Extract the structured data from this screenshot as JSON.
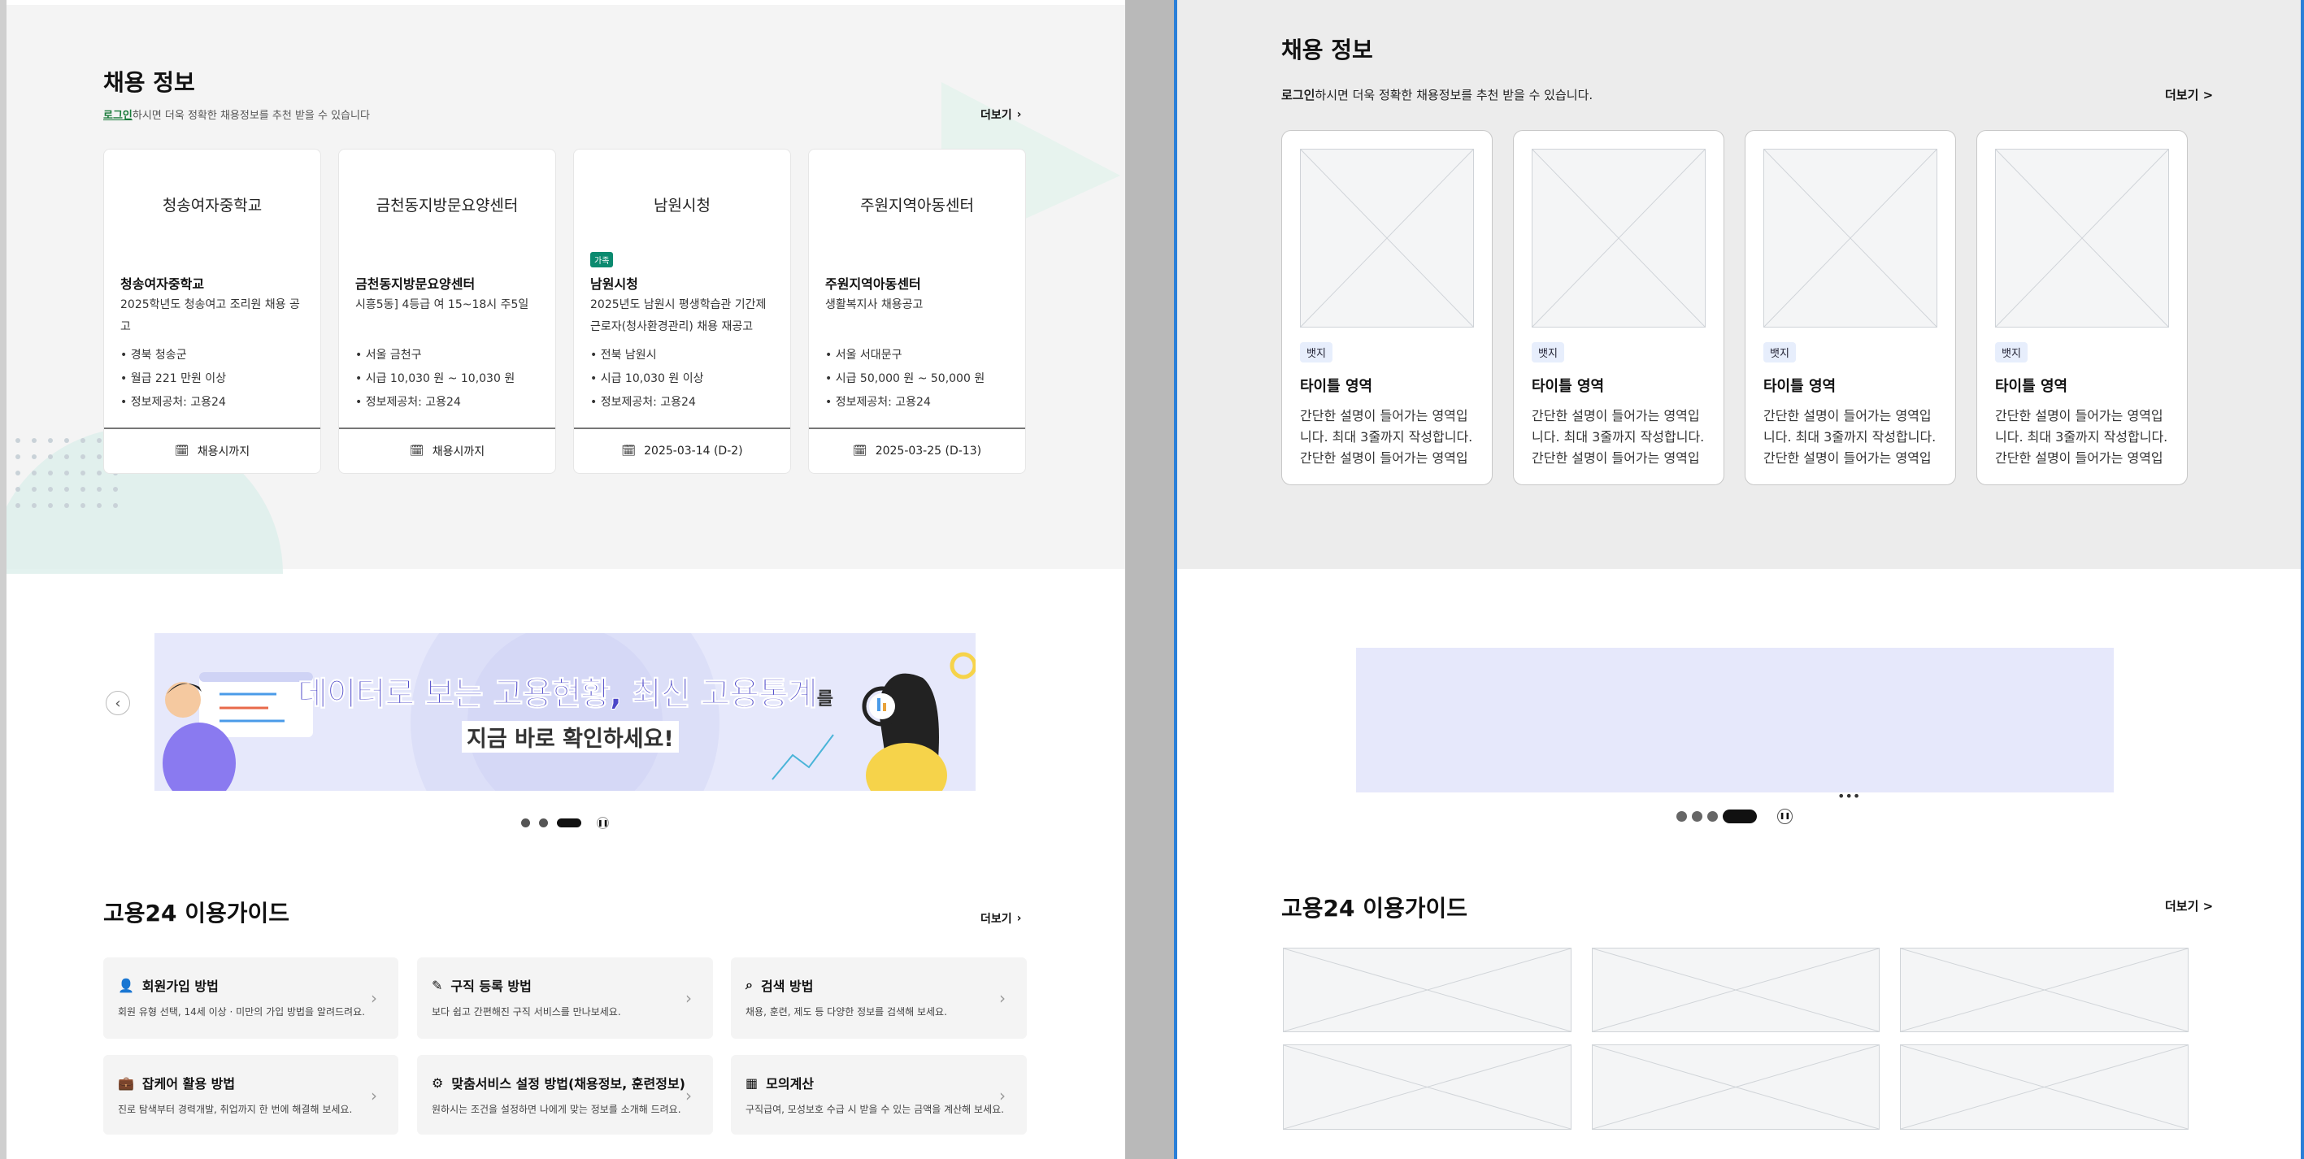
{
  "left": {
    "jobs": {
      "title": "채용 정보",
      "login_link": "로그인",
      "subtitle_rest": "하시면 더욱 정확한 채용정보를 추천 받을 수 있습니다",
      "more": "더보기",
      "cards": [
        {
          "logo": "청송여자중학교",
          "name": "청송여자중학교",
          "desc": "2025학년도 청송여고 조리원 채용 공고",
          "items": [
            "경북 청송군",
            "월급 221 만원 이상",
            "정보제공처: 고용24"
          ],
          "deadline": "채용시까지",
          "badge": ""
        },
        {
          "logo": "금천동지방문요양센터",
          "name": "금천동지방문요양센터",
          "desc": "시흥5동] 4등급 여 15~18시 주5일",
          "items": [
            "서울 금천구",
            "시급 10,030 원 ~ 10,030 원",
            "정보제공처: 고용24"
          ],
          "deadline": "채용시까지",
          "badge": ""
        },
        {
          "logo": "남원시청",
          "name": "남원시청",
          "desc": "2025년도 남원시 평생학습관 기간제근로자(청사환경관리) 채용 재공고",
          "items": [
            "전북 남원시",
            "시급 10,030 원 이상",
            "정보제공처: 고용24"
          ],
          "deadline": "2025-03-14 (D-2)",
          "badge": "가족"
        },
        {
          "logo": "주원지역아동센터",
          "name": "주원지역아동센터",
          "desc": "생활복지사 채용공고",
          "items": [
            "서울 서대문구",
            "시급 50,000 원 ~ 50,000 원",
            "정보제공처: 고용24"
          ],
          "deadline": "2025-03-25 (D-13)",
          "badge": ""
        }
      ]
    },
    "banner": {
      "headline": "데이터로 보는 고용현황, 최신 고용통계",
      "headline_suffix": "를",
      "subline": "지금 바로 확인하세요!"
    },
    "guide": {
      "title": "고용24 이용가이드",
      "more": "더보기",
      "items": [
        {
          "title": "회원가입 방법",
          "desc": "회원 유형 선택, 14세 이상 · 미만의 가입 방법을 알려드려요.",
          "icon": "user-icon"
        },
        {
          "title": "구직 등록 방법",
          "desc": "보다 쉽고 간편해진 구직 서비스를 만나보세요.",
          "icon": "pencil-icon"
        },
        {
          "title": "검색 방법",
          "desc": "채용, 훈련, 제도 등 다양한 정보를 검색해 보세요.",
          "icon": "search-icon"
        },
        {
          "title": "잡케어 활용 방법",
          "desc": "진로 탐색부터 경력개발, 취업까지 한 번에 해결해 보세요.",
          "icon": "briefcase-icon"
        },
        {
          "title": "맞춤서비스 설정 방법(채용정보, 훈련정보)",
          "desc": "원하시는 조건을 설정하면 나에게 맞는 정보를 소개해 드려요.",
          "icon": "gear-icon"
        },
        {
          "title": "모의계산",
          "desc": "구직급여, 모성보호 수급 시 받을 수 있는 금액을 계산해 보세요.",
          "icon": "calculator-icon"
        }
      ]
    }
  },
  "right": {
    "jobs": {
      "title": "채용 정보",
      "login_link": "로그인",
      "subtitle_rest": "하시면 더욱 정확한 채용정보를 추천 받을 수 있습니다.",
      "more": "더보기 >",
      "cards": [
        {
          "badge": "뱃지",
          "title": "타이틀 영역",
          "desc": "간단한 설명이 들어가는 영역입니다. 최대 3줄까지 작성합니다. 간단한 설명이 들어가는 영역입니다."
        },
        {
          "badge": "뱃지",
          "title": "타이틀 영역",
          "desc": "간단한 설명이 들어가는 영역입니다. 최대 3줄까지 작성합니다. 간단한 설명이 들어가는 영역입니다."
        },
        {
          "badge": "뱃지",
          "title": "타이틀 영역",
          "desc": "간단한 설명이 들어가는 영역입니다. 최대 3줄까지 작성합니다. 간단한 설명이 들어가는 영역입니다."
        },
        {
          "badge": "뱃지",
          "title": "타이틀 영역",
          "desc": "간단한 설명이 들어가는 영역입니다. 최대 3줄까지 작성합니다. 간단한 설명이 들어가는 영역입니다."
        }
      ]
    },
    "guide": {
      "title": "고용24 이용가이드",
      "more": "더보기 >"
    }
  },
  "colors": {
    "accent_green": "#0b8a6f",
    "login_green": "#1a7a3a",
    "banner_bg": "#e6e8fb",
    "banner_headline": "#4b46c8",
    "wireframe_border": "#2a7fd8"
  }
}
